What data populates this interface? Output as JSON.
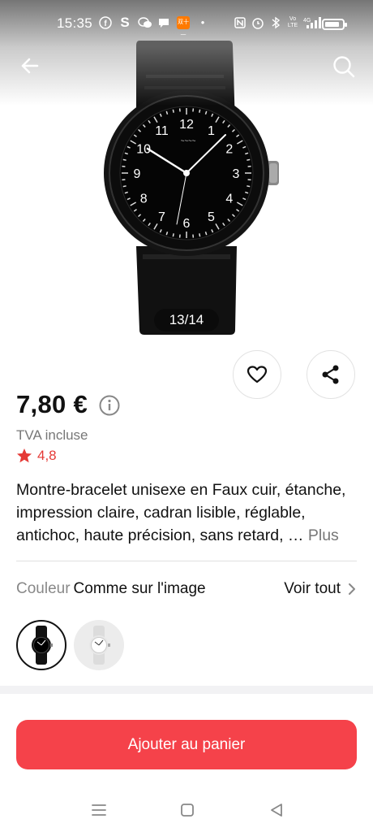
{
  "status_bar": {
    "time": "15:35",
    "left_icons": [
      "facebook-icon",
      "s-app-icon",
      "wechat-icon",
      "message-icon",
      "aliexpress-icon",
      "dot-icon"
    ],
    "right_icons": [
      "nfc-icon",
      "alarm-icon",
      "bluetooth-icon",
      "volte-icon",
      "signal-4g-icon"
    ],
    "aliexpress_badge": "双十一",
    "network": "4G",
    "volte": "Vo LTE",
    "battery_level": 0.85
  },
  "header": {
    "back_icon": "arrow-left-icon",
    "search_icon": "search-icon"
  },
  "gallery": {
    "counter": "13/14",
    "watch_numbers": [
      "12",
      "1",
      "2",
      "3",
      "4",
      "5",
      "6",
      "7",
      "8",
      "9",
      "10",
      "11"
    ]
  },
  "product": {
    "price": "7,80 €",
    "tax_note": "TVA incluse",
    "rating": "4,8",
    "title": "Montre-bracelet unisexe en Faux cuir, étanche, impression claire, cadran lisible, réglable, antichoc, haute précision, sans retard, …",
    "more_label": "Plus"
  },
  "color": {
    "label": "Couleur",
    "value": "Comme sur l'image",
    "see_all": "Voir tout",
    "swatches": [
      {
        "name": "black",
        "selected": true
      },
      {
        "name": "white",
        "selected": false
      }
    ]
  },
  "cart": {
    "add_label": "Ajouter au panier"
  },
  "colors": {
    "accent": "#f5424a",
    "rating": "#e53935",
    "muted": "#777777"
  }
}
